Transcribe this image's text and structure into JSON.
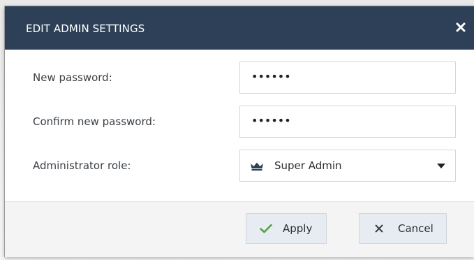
{
  "dialog": {
    "title": "EDIT ADMIN SETTINGS",
    "close_icon": "close-icon",
    "accent_color": "#2e4058"
  },
  "form": {
    "new_password": {
      "label": "New password:",
      "value": "••••••"
    },
    "confirm_password": {
      "label": "Confirm new password:",
      "value": "••••••"
    },
    "role": {
      "label": "Administrator role:",
      "selected": "Super Admin",
      "icon": "crown-icon"
    }
  },
  "footer": {
    "apply_label": "Apply",
    "apply_icon": "check-icon",
    "apply_icon_color": "#5aa04a",
    "cancel_label": "Cancel",
    "cancel_icon": "close-icon"
  }
}
